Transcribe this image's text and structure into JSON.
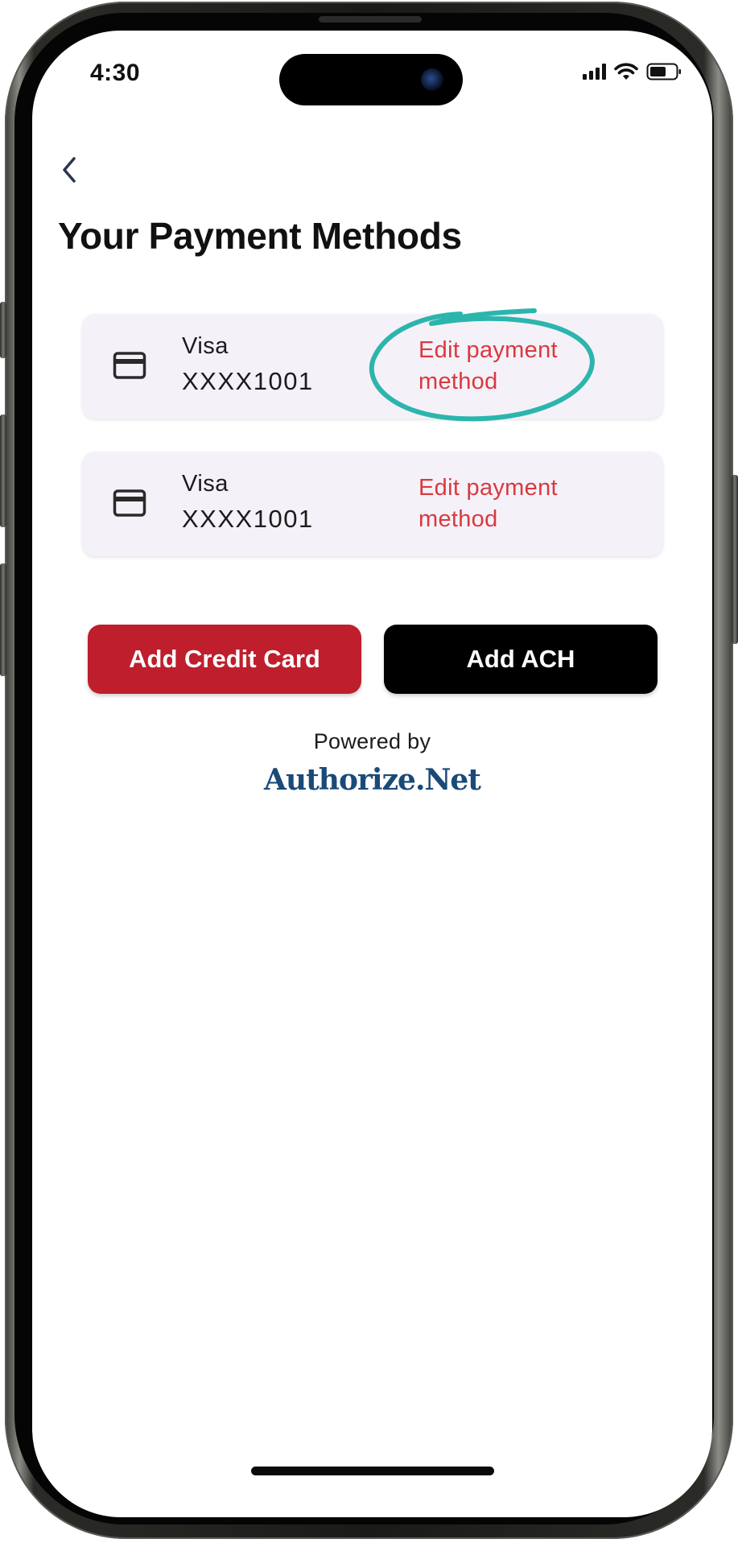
{
  "status_bar": {
    "time": "4:30"
  },
  "header": {
    "back_icon": "chevron-left-icon",
    "title": "Your Payment Methods"
  },
  "payment_methods": [
    {
      "icon": "credit-card-icon",
      "brand": "Visa",
      "number": "XXXX1001",
      "edit_label": "Edit payment method",
      "annotated": true
    },
    {
      "icon": "credit-card-icon",
      "brand": "Visa",
      "number": "XXXX1001",
      "edit_label": "Edit payment method",
      "annotated": false
    }
  ],
  "actions": {
    "add_credit_card_label": "Add Credit Card",
    "add_ach_label": "Add ACH"
  },
  "footer": {
    "powered_by": "Powered by",
    "logo_text": "Authorize.Net"
  },
  "colors": {
    "accent_red": "#bf1e2d",
    "edit_link": "#d9393f",
    "annotation_teal": "#2bb5ad",
    "card_bg": "#f5f1f8",
    "logo_blue": "#1a4a78"
  }
}
